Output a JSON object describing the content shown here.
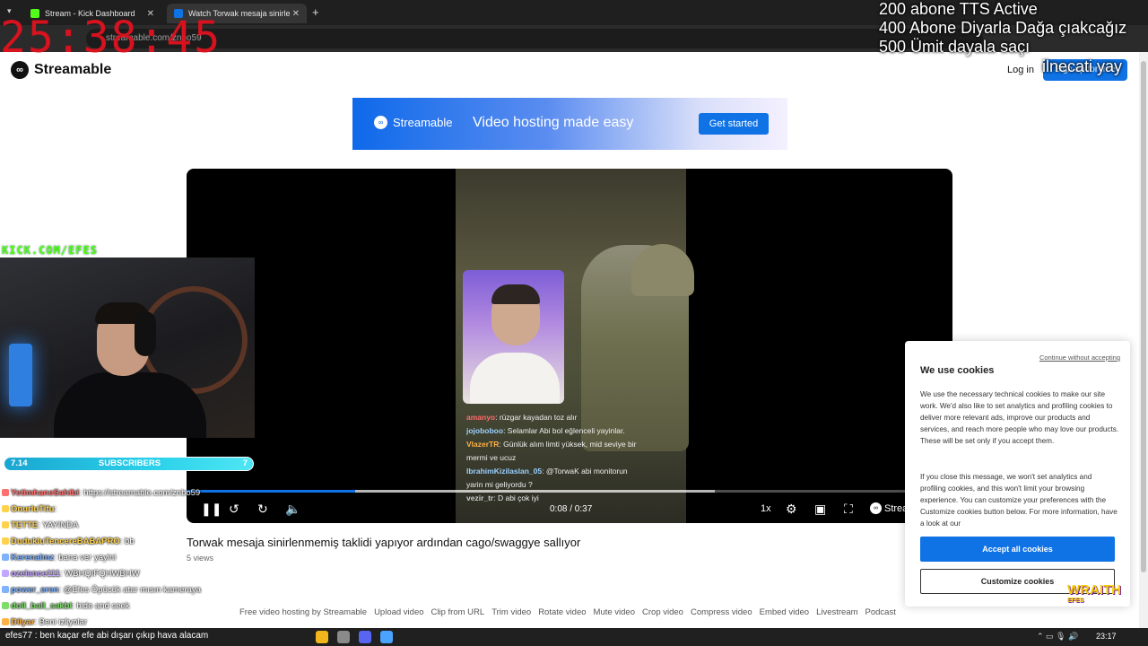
{
  "browser": {
    "tabs": [
      {
        "title": "Stream - Kick Dashboard",
        "color": "#53fc18"
      },
      {
        "title": "Watch Torwak mesaja sinirle",
        "color": "#0f72e5"
      }
    ],
    "url": "streamable.com/znbo59"
  },
  "site": {
    "brand": "Streamable",
    "login": "Log in",
    "signup": "Sign up for free"
  },
  "banner": {
    "brand": "Streamable",
    "tagline": "Video hosting made easy",
    "cta": "Get started"
  },
  "player": {
    "played_fraction": 0.22,
    "buffered_fraction": 0.69,
    "time": "0:08 / 0:37",
    "speed": "1x",
    "brand": "Streamable",
    "chat": [
      {
        "user": "amanyo",
        "text": ": rüzgar kayadan toz alır",
        "color": "#ff6b6b"
      },
      {
        "user": "jojoboboo",
        "text": ": Selamlar Abi bol eğlenceli yayinlar.",
        "color": "#9ad0ff"
      },
      {
        "user": "VlazerTR",
        "text": ": Günlük alım limti yüksek, mid seviye bir mermi ve ucuz",
        "color": "#ffb347"
      },
      {
        "user": "IbrahimKizilaslan_05",
        "text": ": @TorwaK abi monitorun yarin mi geliyordu ?",
        "color": "#9ad0ff"
      },
      {
        "user": "vezir_tr",
        "text": ": D abi çok iyi",
        "color": "#cccccc"
      }
    ]
  },
  "video": {
    "title": "Torwak mesaja sinirlenmemiş taklidi yapıyor ardından cago/swaggye sallıyor",
    "views": "5 views"
  },
  "footer_links": [
    "Free video hosting by Streamable",
    "Upload video",
    "Clip from URL",
    "Trim video",
    "Rotate video",
    "Mute video",
    "Crop video",
    "Compress video",
    "Embed video",
    "Livestream",
    "Podcast"
  ],
  "cookies": {
    "skip": "Continue without accepting",
    "title": "We use cookies",
    "para1": "We use the necessary technical cookies to make our site work. We'd also like to set analytics and profiling cookies to deliver more relevant ads, improve our products and services, and reach more people who may love our products. These will be set only if you accept them.",
    "para2": "If you close this message, we won't set analytics and profiling cookies, and this won't limit your browsing experience. You can customize your preferences with the Customize cookies button below. For more information, have a look at our",
    "accept": "Accept all cookies",
    "customize": "Customize cookies"
  },
  "overlay": {
    "timer": "25:38:45",
    "goals": [
      "200 abone TTS Active",
      "400 Abone Diyarla Dağa çıakcağız",
      "500 Ümit dayala saçı"
    ],
    "goal_extra": "ilnecati yay",
    "kick_url": "KICK.COM/EFES",
    "subs_left": "7.14",
    "subs_label": "SUBSCRIBERS",
    "subs_right": "7",
    "chat": [
      {
        "name": "YetimhaneSahibi",
        "msg": ": https://streamable.com/znbo59",
        "color": "#ff7070"
      },
      {
        "name": "OnurluTifu",
        "msg": ":",
        "color": "#ffd24d"
      },
      {
        "name": "TETTE",
        "msg": ": YAYINDA",
        "color": "#ffd24d"
      },
      {
        "name": "DudukluTencereBABAPRO",
        "msg": ": bb",
        "color": "#ffd24d"
      },
      {
        "name": "Kerenalmz",
        "msg": ": bana ver yayini",
        "color": "#7fb2ff"
      },
      {
        "name": "ozelance111",
        "msg": ": WBHQIFQHWBHW",
        "color": "#c3a6ff"
      },
      {
        "name": "power_eren",
        "msg": ": @Efes Öpücük atar mısın kameraya",
        "color": "#7fb2ff"
      },
      {
        "name": "doll_ball_sakbl",
        "msg": ": hide and seek",
        "color": "#7ddc6a"
      },
      {
        "name": "Dilyar",
        "msg": ": Beni izliyolar",
        "color": "#ffb347"
      }
    ],
    "wraith": "WRAITH",
    "wraith_sub": "EFES"
  },
  "taskbar": {
    "search_text": "efes77 : ben kaçar efe abi dışarı çıkıp hava alacam",
    "apps": [
      "#f3b51c",
      "#8a8a8a",
      "#5865f2",
      "#4aa3ff"
    ],
    "clock": "23:17"
  }
}
